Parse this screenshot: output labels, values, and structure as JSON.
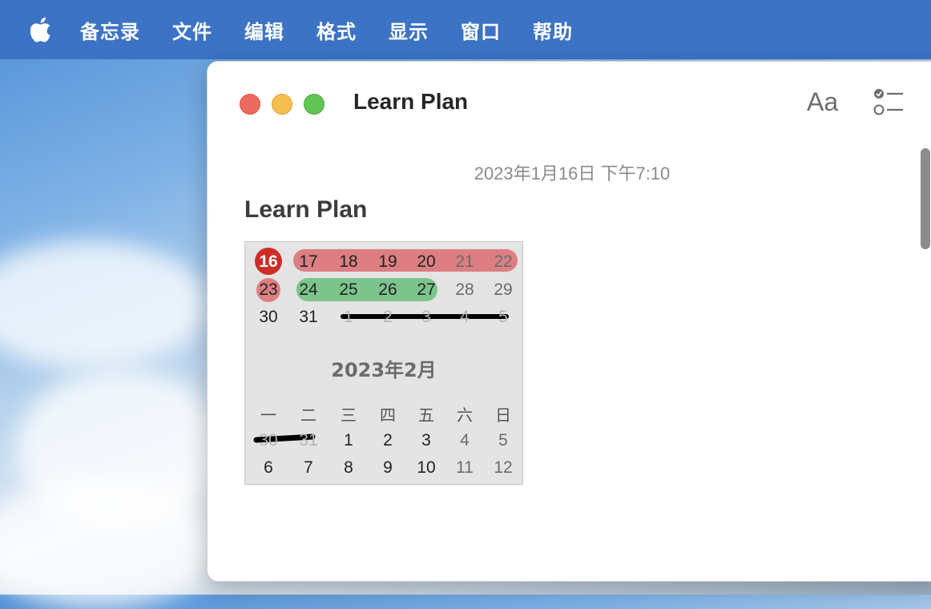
{
  "menubar": {
    "apple_icon": "apple-logo-icon",
    "items": [
      "备忘录",
      "文件",
      "编辑",
      "格式",
      "显示",
      "窗口",
      "帮助"
    ]
  },
  "window": {
    "title": "Learn Plan",
    "format_button_label": "Aa",
    "checklist_icon": "checklist-icon"
  },
  "note": {
    "date": "2023年1月16日 下午7:10",
    "heading": "Learn Plan"
  },
  "calendar": {
    "row1": [
      "16",
      "17",
      "18",
      "19",
      "20",
      "21",
      "22"
    ],
    "row2": [
      "23",
      "24",
      "25",
      "26",
      "27",
      "28",
      "29"
    ],
    "row3": [
      "30",
      "31",
      "1",
      "2",
      "3",
      "4",
      "5"
    ],
    "month_title": "2023年2月",
    "weekdays": [
      "一",
      "二",
      "三",
      "四",
      "五",
      "六",
      "日"
    ],
    "row4": [
      "30",
      "31",
      "1",
      "2",
      "3",
      "4",
      "5"
    ],
    "row5": [
      "6",
      "7",
      "8",
      "9",
      "10",
      "11",
      "12"
    ],
    "colors": {
      "today": "#cc2e27",
      "red_highlight": "#dd7f82",
      "green_highlight": "#7cc48c",
      "strike": "#000000"
    }
  }
}
